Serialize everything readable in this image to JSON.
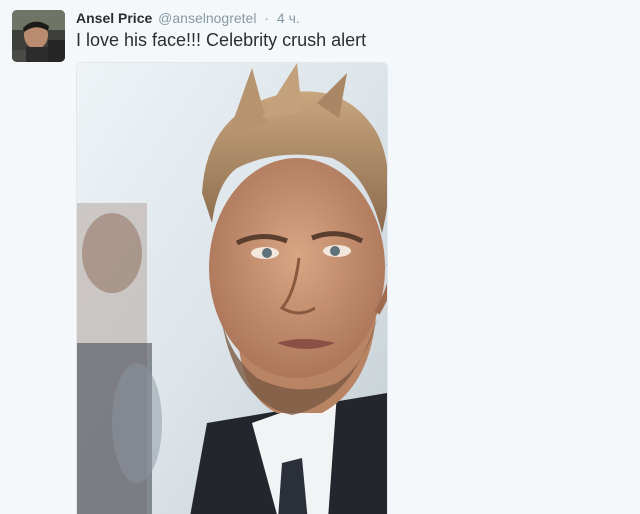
{
  "tweet": {
    "author_name": "Ansel Price",
    "author_handle": "@anselnogretel",
    "separator": "·",
    "timestamp": "4 ч.",
    "text": "I love his face!!! Celebrity crush alert"
  },
  "colors": {
    "background": "#f5f8fa",
    "name": "#292f33",
    "meta": "#8899a6"
  },
  "icons": {
    "avatar": "user-avatar-photo",
    "media": "attached-photo"
  }
}
